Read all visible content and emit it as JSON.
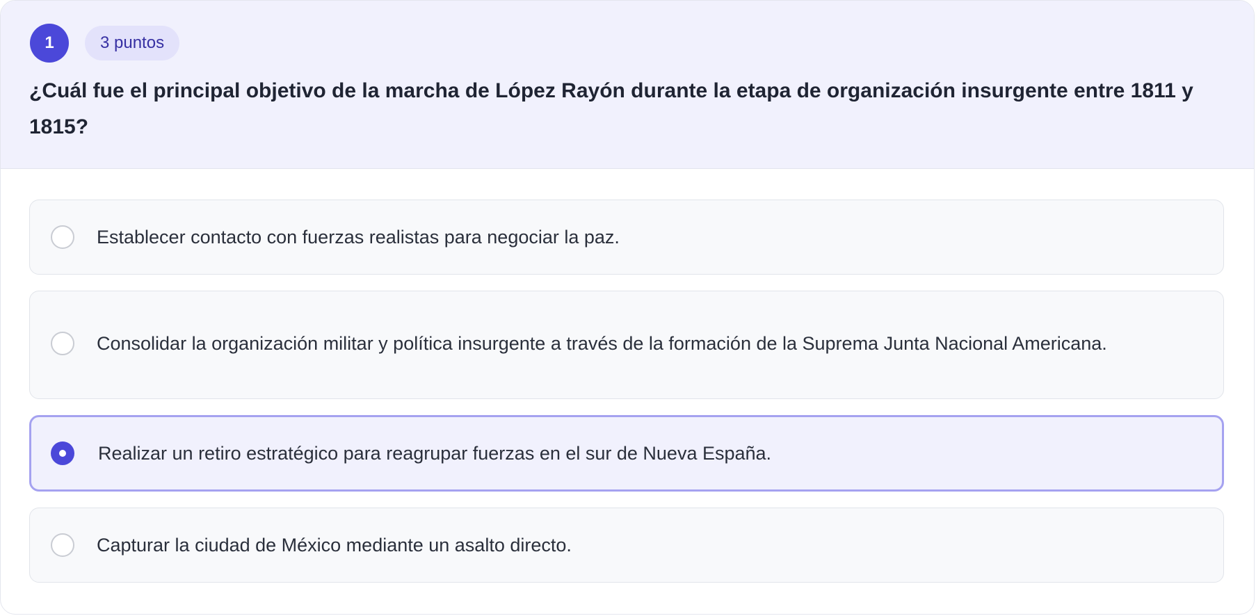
{
  "question": {
    "number": "1",
    "points": "3 puntos",
    "text": "¿Cuál fue el principal objetivo de la marcha de López Rayón durante la etapa de organización insurgente entre 1811 y 1815?"
  },
  "options": [
    {
      "text": "Establecer contacto con fuerzas realistas para negociar la paz.",
      "selected": false
    },
    {
      "text": "Consolidar la organización militar y política insurgente a través de la formación de la Suprema Junta Nacional Americana.",
      "selected": false
    },
    {
      "text": "Realizar un retiro estratégico para reagrupar fuerzas en el sur de Nueva España.",
      "selected": true
    },
    {
      "text": "Capturar la ciudad de México mediante un asalto directo.",
      "selected": false
    }
  ],
  "colors": {
    "accent": "#4b48d9",
    "header_background": "#f1f1fd",
    "badge_background": "#e3e2fb",
    "badge_text": "#3730a3",
    "selected_border": "#a5a2f0",
    "option_background": "#f8f9fb"
  }
}
